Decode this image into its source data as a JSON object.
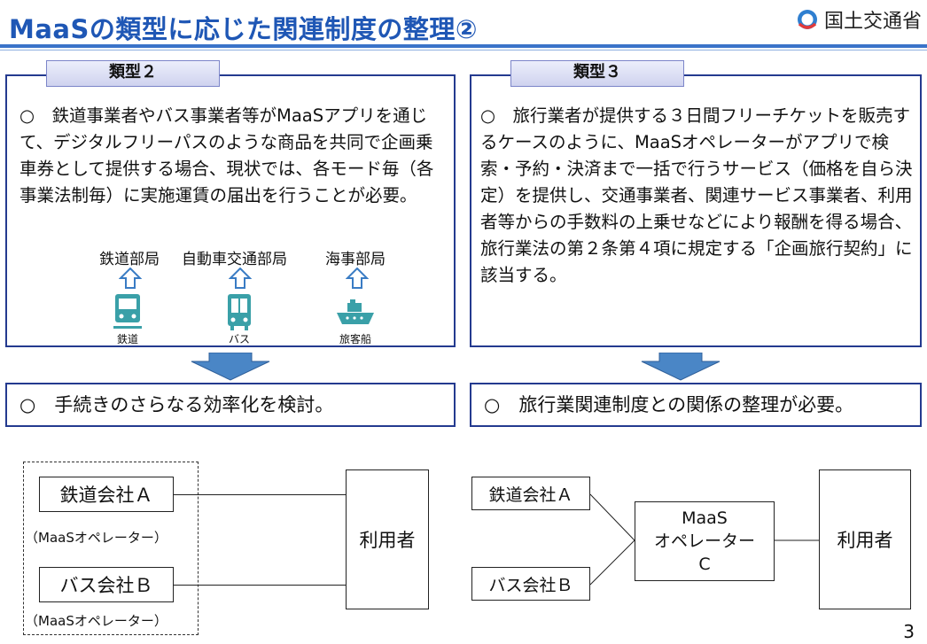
{
  "header": {
    "title": "MaaSの類型に応じた関連制度の整理②",
    "ministry": "国土交通省"
  },
  "left_panel": {
    "tab": "類型２",
    "body": "○　鉄道事業者やバス事業者等がMaaSアプリを通じて、デジタルフリーパスのような商品を共同で企画乗車券として提供する場合、現状では、各モード毎（各事業法制毎）に実施運賃の届出を行うことが必要。",
    "agencies": [
      "鉄道部局",
      "自動車交通部局",
      "海事部局"
    ],
    "modes": [
      {
        "label": "鉄道",
        "icon": "train-icon"
      },
      {
        "label": "バス",
        "icon": "bus-icon"
      },
      {
        "label": "旅客船",
        "icon": "ship-icon"
      }
    ],
    "conclusion": "○　手続きのさらなる効率化を検討。"
  },
  "right_panel": {
    "tab": "類型３",
    "body": "○　旅行業者が提供する３日間フリーチケットを販売するケースのように、MaaSオペレーターがアプリで検索・予約・決済まで一括で行うサービス（価格を自ら決定）を提供し、交通事業者、関連サービス事業者、利用者等からの手数料の上乗せなどにより報酬を得る場合、旅行業法の第２条第４項に規定する「企画旅行契約」に該当する。",
    "conclusion": "○　旅行業関連制度との関係の整理が必要。"
  },
  "left_diagram": {
    "company_a": "鉄道会社Ａ",
    "company_a_note": "（MaaSオペレーター）",
    "company_b": "バス会社Ｂ",
    "company_b_note": "（MaaSオペレーター）",
    "user": "利用者"
  },
  "right_diagram": {
    "company_a": "鉄道会社Ａ",
    "company_b": "バス会社Ｂ",
    "operator": "MaaS\nオペレーター\nC",
    "user": "利用者"
  },
  "page_number": "3",
  "colors": {
    "title": "#1f57b5",
    "panel_border": "#243a8f",
    "icon": "#3aa0a8",
    "arrow": "#4a86c6"
  }
}
